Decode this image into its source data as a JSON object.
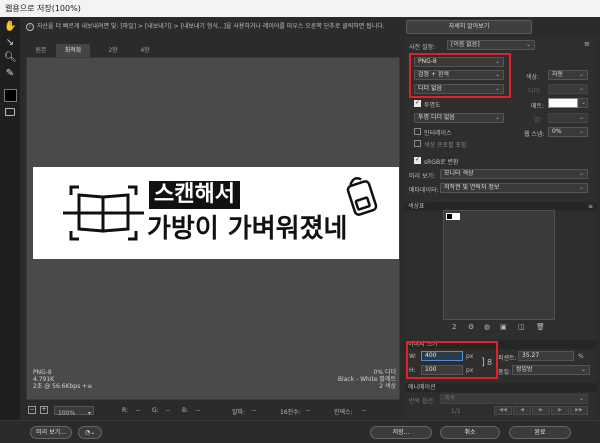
{
  "window": {
    "title": "웹용으로 저장(100%)"
  },
  "hint": "자산을 더 빠르게 내보내려면 빛: [파일] > [내보내기] > [내보내기 형식...]을 사용하거나 레이어를 마우스 오른쪽 단추로 클릭하면 됩니다.",
  "device_button": "자세히 알아보기",
  "tabs": [
    "원본",
    "최적화",
    "2장",
    "4장"
  ],
  "canvas": {
    "line1": "스캔해서",
    "line2": "가방이 가벼워졌네"
  },
  "image_info": {
    "format": "PNG-8",
    "size": "4.791K",
    "time": "2초 @ 56.6Kbps",
    "menu": "+≡",
    "dither": "0% 디더",
    "palette": "Black - White 팔레트",
    "colors": "2 색상"
  },
  "statusbar": {
    "zoom": "100%",
    "r": "R:",
    "g": "G:",
    "b": "B:",
    "dash": "--",
    "alpha": "알파:",
    "hex": "16진수:",
    "index": "인덱스:"
  },
  "bottom": {
    "preview": "미리 보기...",
    "save": "저장...",
    "cancel": "취소",
    "done": "완료"
  },
  "panel": {
    "preset_label": "사전 설정:",
    "preset_value": "[이름 없음]",
    "format": "PNG-8",
    "reduction": "검정 + 흰색",
    "colors_label": "색상:",
    "colors_value": "자동",
    "dither_type": "디더 없음",
    "dither_label": "디더:",
    "transparency_label": "투명도",
    "matte_label": "매트:",
    "trans_dither": "투명 디더 없음",
    "amount_label": "양:",
    "interlaced_label": "인터레이스",
    "websnap_label": "웹 스냅:",
    "websnap_value": "0%",
    "color_profile_label": "색상 프로필 포함",
    "srgb_label": "sRGB로 변환",
    "preview_label": "미리 보기:",
    "preview_value": "모니터 색상",
    "metadata_label": "메타데이터:",
    "metadata_value": "저작권 및 연락처 정보",
    "color_table_title": "색상표",
    "color_count": "2",
    "image_size_title": "이미지 크기",
    "w_label": "W:",
    "w_value": "400",
    "h_label": "H:",
    "h_value": "100",
    "px": "px",
    "percent_label": "퍼센트:",
    "percent_value": "35.27",
    "percent_unit": "%",
    "quality_label": "품질:",
    "quality_value": "쌍입방",
    "animation_title": "애니메이션",
    "loop_label": "반복 옵션:",
    "loop_value": "계속",
    "frame": "1/1"
  },
  "colors": {
    "accent_red": "#e0202a",
    "focus_blue": "#4a8fd6"
  }
}
